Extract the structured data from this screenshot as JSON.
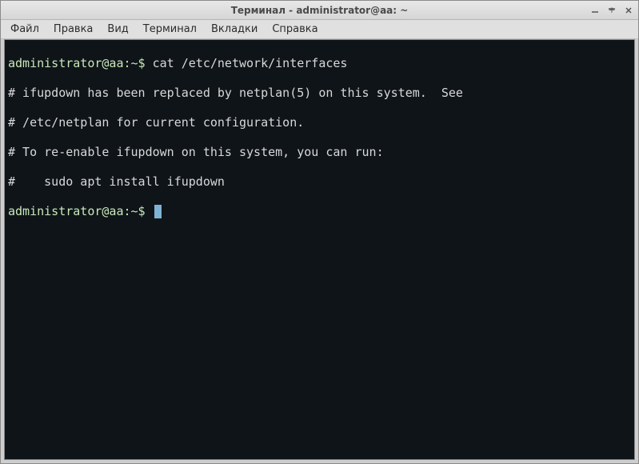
{
  "window": {
    "title": "Терминал - administrator@aa: ~"
  },
  "menubar": {
    "items": [
      "Файл",
      "Правка",
      "Вид",
      "Терминал",
      "Вкладки",
      "Справка"
    ]
  },
  "terminal": {
    "prompt1": "administrator@aa:~$",
    "command1": " cat /etc/network/interfaces",
    "output": [
      "# ifupdown has been replaced by netplan(5) on this system.  See",
      "# /etc/netplan for current configuration.",
      "# To re-enable ifupdown on this system, you can run:",
      "#    sudo apt install ifupdown"
    ],
    "prompt2": "administrator@aa:~$"
  }
}
